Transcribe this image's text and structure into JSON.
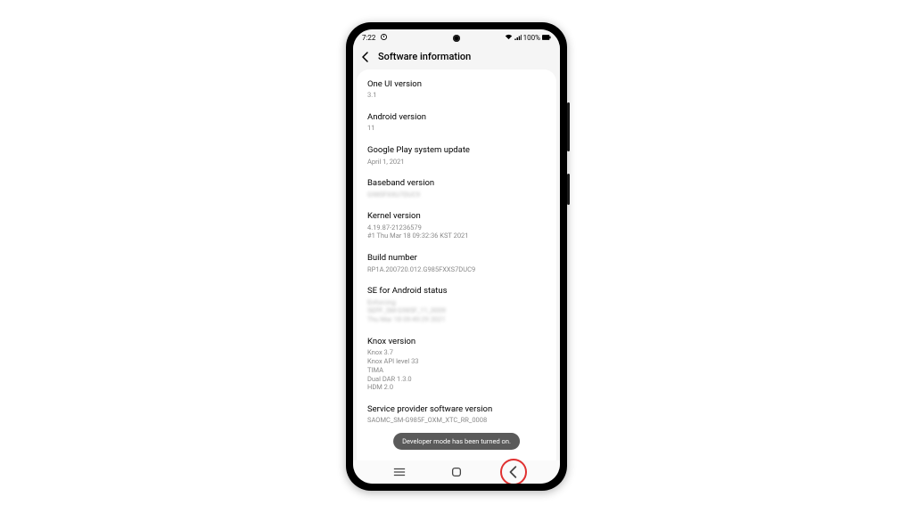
{
  "statusbar": {
    "time": "7:22",
    "battery_pct": "100%"
  },
  "header": {
    "title": "Software information"
  },
  "items": [
    {
      "title": "One UI version",
      "value": "3.1"
    },
    {
      "title": "Android version",
      "value": "11"
    },
    {
      "title": "Google Play system update",
      "value": "April 1, 2021"
    },
    {
      "title": "Baseband version",
      "value": "G985FXXU7DUC9",
      "blur": true
    },
    {
      "title": "Kernel version",
      "value": "4.19.87-21236579\n#1 Thu Mar 18 09:32:36 KST 2021"
    },
    {
      "title": "Build number",
      "value": "RP1A.200720.012.G985FXXS7DUC9"
    },
    {
      "title": "SE for Android status",
      "value": "Enforcing\nSEPF_SM-G985F_11_0009\nThu Mar 18 09:49:29 2021",
      "blur": true
    },
    {
      "title": "Knox version",
      "value": "Knox 3.7\nKnox API level 33\nTIMA\nDual DAR 1.3.0\nHDM 2.0"
    },
    {
      "title": "Service provider software version",
      "value": "SAOMC_SM-G985F_OXM_XTC_RR_0008"
    }
  ],
  "toast": {
    "text": "Developer mode has been turned on."
  }
}
